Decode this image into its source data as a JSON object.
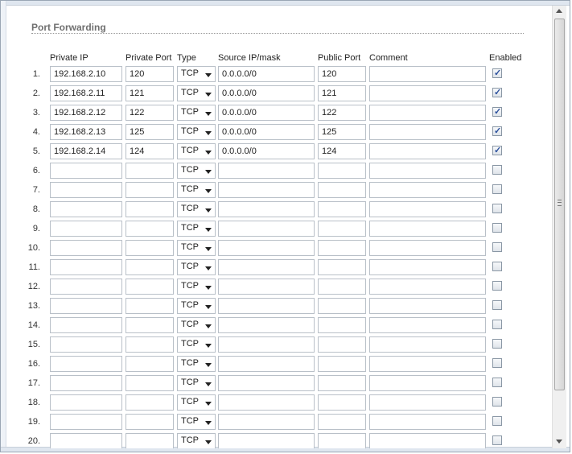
{
  "section": {
    "title": "Port Forwarding"
  },
  "columns": {
    "private_ip": "Private IP",
    "private_port": "Private Port",
    "type": "Type",
    "source": "Source IP/mask",
    "public_port": "Public Port",
    "comment": "Comment",
    "enabled": "Enabled"
  },
  "rows": [
    {
      "num": "1.",
      "private_ip": "192.168.2.10",
      "private_port": "120",
      "type": "TCP",
      "source": "0.0.0.0/0",
      "public_port": "120",
      "comment": "",
      "enabled": true
    },
    {
      "num": "2.",
      "private_ip": "192.168.2.11",
      "private_port": "121",
      "type": "TCP",
      "source": "0.0.0.0/0",
      "public_port": "121",
      "comment": "",
      "enabled": true
    },
    {
      "num": "3.",
      "private_ip": "192.168.2.12",
      "private_port": "122",
      "type": "TCP",
      "source": "0.0.0.0/0",
      "public_port": "122",
      "comment": "",
      "enabled": true
    },
    {
      "num": "4.",
      "private_ip": "192.168.2.13",
      "private_port": "125",
      "type": "TCP",
      "source": "0.0.0.0/0",
      "public_port": "125",
      "comment": "",
      "enabled": true
    },
    {
      "num": "5.",
      "private_ip": "192.168.2.14",
      "private_port": "124",
      "type": "TCP",
      "source": "0.0.0.0/0",
      "public_port": "124",
      "comment": "",
      "enabled": true
    },
    {
      "num": "6.",
      "private_ip": "",
      "private_port": "",
      "type": "TCP",
      "source": "",
      "public_port": "",
      "comment": "",
      "enabled": false
    },
    {
      "num": "7.",
      "private_ip": "",
      "private_port": "",
      "type": "TCP",
      "source": "",
      "public_port": "",
      "comment": "",
      "enabled": false
    },
    {
      "num": "8.",
      "private_ip": "",
      "private_port": "",
      "type": "TCP",
      "source": "",
      "public_port": "",
      "comment": "",
      "enabled": false
    },
    {
      "num": "9.",
      "private_ip": "",
      "private_port": "",
      "type": "TCP",
      "source": "",
      "public_port": "",
      "comment": "",
      "enabled": false
    },
    {
      "num": "10.",
      "private_ip": "",
      "private_port": "",
      "type": "TCP",
      "source": "",
      "public_port": "",
      "comment": "",
      "enabled": false
    },
    {
      "num": "11.",
      "private_ip": "",
      "private_port": "",
      "type": "TCP",
      "source": "",
      "public_port": "",
      "comment": "",
      "enabled": false
    },
    {
      "num": "12.",
      "private_ip": "",
      "private_port": "",
      "type": "TCP",
      "source": "",
      "public_port": "",
      "comment": "",
      "enabled": false
    },
    {
      "num": "13.",
      "private_ip": "",
      "private_port": "",
      "type": "TCP",
      "source": "",
      "public_port": "",
      "comment": "",
      "enabled": false
    },
    {
      "num": "14.",
      "private_ip": "",
      "private_port": "",
      "type": "TCP",
      "source": "",
      "public_port": "",
      "comment": "",
      "enabled": false
    },
    {
      "num": "15.",
      "private_ip": "",
      "private_port": "",
      "type": "TCP",
      "source": "",
      "public_port": "",
      "comment": "",
      "enabled": false
    },
    {
      "num": "16.",
      "private_ip": "",
      "private_port": "",
      "type": "TCP",
      "source": "",
      "public_port": "",
      "comment": "",
      "enabled": false
    },
    {
      "num": "17.",
      "private_ip": "",
      "private_port": "",
      "type": "TCP",
      "source": "",
      "public_port": "",
      "comment": "",
      "enabled": false
    },
    {
      "num": "18.",
      "private_ip": "",
      "private_port": "",
      "type": "TCP",
      "source": "",
      "public_port": "",
      "comment": "",
      "enabled": false
    },
    {
      "num": "19.",
      "private_ip": "",
      "private_port": "",
      "type": "TCP",
      "source": "",
      "public_port": "",
      "comment": "",
      "enabled": false
    },
    {
      "num": "20.",
      "private_ip": "",
      "private_port": "",
      "type": "TCP",
      "source": "",
      "public_port": "",
      "comment": "",
      "enabled": false
    }
  ],
  "icons": {
    "checkbox": "checkbox-icon",
    "dropdown": "chevron-down-icon",
    "scroll_up": "scroll-up-icon",
    "scroll_down": "scroll-down-icon"
  },
  "colors": {
    "check": "#2a4f9c",
    "border": "#b9c0c8",
    "title": "#707070"
  }
}
